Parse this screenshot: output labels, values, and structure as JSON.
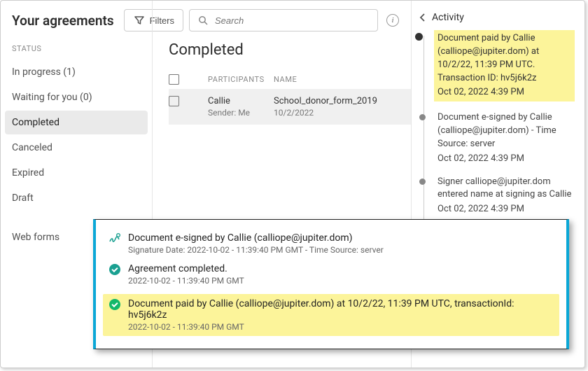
{
  "header": {
    "title": "Your agreements",
    "filters_label": "Filters",
    "search_placeholder": "Search"
  },
  "sidebar": {
    "status_label": "STATUS",
    "items": [
      {
        "label": "In progress (1)"
      },
      {
        "label": "Waiting for you (0)"
      },
      {
        "label": "Completed"
      },
      {
        "label": "Canceled"
      },
      {
        "label": "Expired"
      },
      {
        "label": "Draft"
      }
    ],
    "webforms": "Web forms"
  },
  "main": {
    "heading": "Completed",
    "columns": {
      "participants": "PARTICIPANTS",
      "name": "NAME"
    },
    "row": {
      "participant": "Callie",
      "sender": "Sender: Me",
      "name": "School_donor_form_2019",
      "date": "10/2/2022"
    }
  },
  "activity": {
    "title": "Activity",
    "items": [
      {
        "text": "Document paid by Callie (calliope@jupiter.dom) at 10/2/22, 11:39 PM UTC. Transaction ID: hv5j6k2z",
        "ts": "Oct 02, 2022 4:39 PM",
        "highlight": true
      },
      {
        "text": "Document e-signed by Callie (calliope@jupiter.dom) - Time Source: server",
        "ts": "Oct 02, 2022 4:39 PM",
        "highlight": false
      },
      {
        "text": "Signer calliope@jupiter.dom entered name at signing as Callie",
        "ts": "Oct 02, 2022 4:39 PM",
        "highlight": false
      }
    ]
  },
  "overlay": {
    "items": [
      {
        "icon": "signature",
        "line1": "Document e-signed by Callie (calliope@jupiter.dom)",
        "line2": "Signature Date: 2022-10-02 - 11:39:40 PM GMT - Time Source: server",
        "highlight": false
      },
      {
        "icon": "check",
        "line1": "Agreement completed.",
        "line2": "2022-10-02 - 11:39:40 PM GMT",
        "highlight": false
      },
      {
        "icon": "check-bright",
        "line1": "Document paid by Callie (calliope@jupiter.dom) at 10/2/22, 11:39 PM UTC, transactionId: hv5j6k2z",
        "line2": "2022-10-02 - 11:39:40 PM GMT",
        "highlight": true
      }
    ]
  }
}
